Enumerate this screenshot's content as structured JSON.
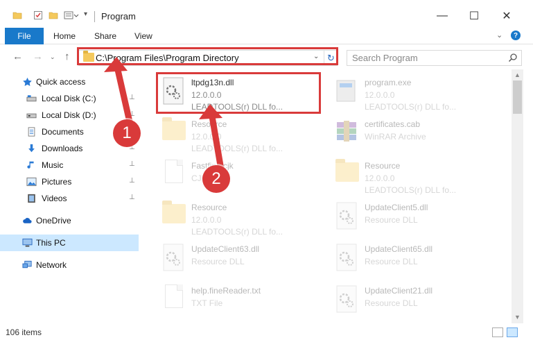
{
  "window": {
    "title": "Program",
    "minimize_glyph": "—",
    "maximize_glyph": "☐",
    "close_glyph": "✕"
  },
  "ribbon": {
    "tabs": [
      "File",
      "Home",
      "Share",
      "View"
    ],
    "help_label": "?"
  },
  "address": {
    "path": "C:\\Program Files\\Program Directory",
    "search_placeholder": "Search Program"
  },
  "nav": {
    "items": [
      {
        "label": "Quick access",
        "icon": "star-icon",
        "pinned": false
      },
      {
        "label": "Local Disk (C:)",
        "icon": "drive-icon",
        "pinned": true
      },
      {
        "label": "Local Disk (D:)",
        "icon": "drive-icon",
        "pinned": true
      },
      {
        "label": "Documents",
        "icon": "documents-icon",
        "pinned": true
      },
      {
        "label": "Downloads",
        "icon": "downloads-icon",
        "pinned": true
      },
      {
        "label": "Music",
        "icon": "music-icon",
        "pinned": true
      },
      {
        "label": "Pictures",
        "icon": "pictures-icon",
        "pinned": true
      },
      {
        "label": "Videos",
        "icon": "videos-icon",
        "pinned": true
      },
      {
        "label": "OneDrive",
        "icon": "onedrive-icon",
        "pinned": false
      },
      {
        "label": "This PC",
        "icon": "pc-icon",
        "pinned": false,
        "selected": true
      },
      {
        "label": "Network",
        "icon": "network-icon",
        "pinned": false
      }
    ],
    "pin_glyph": "📌"
  },
  "files": [
    {
      "name": "ltpdg13n.dll",
      "meta": "12.0.0.0",
      "meta2": "LEADTOOLS(r) DLL fo...",
      "kind": "dll-gear",
      "highlight": true
    },
    {
      "name": "program.exe",
      "meta": "12.0.0.0",
      "meta2": "LEADTOOLS(r) DLL fo...",
      "kind": "exe"
    },
    {
      "name": "Resource",
      "meta": "12.0.0.0",
      "meta2": "LEADTOOLS(r) DLL fo...",
      "kind": "folder"
    },
    {
      "name": "certificates.cab",
      "meta": "WinRAR Archive",
      "meta2": "",
      "kind": "archive"
    },
    {
      "name": "Fastfind.cjk",
      "meta": "CJK File",
      "meta2": "",
      "kind": "doc"
    },
    {
      "name": "Resource",
      "meta": "12.0.0.0",
      "meta2": "LEADTOOLS(r) DLL fo...",
      "kind": "folder"
    },
    {
      "name": "Resource",
      "meta": "12.0.0.0",
      "meta2": "LEADTOOLS(r) DLL fo...",
      "kind": "folder"
    },
    {
      "name": "UpdateClient5.dll",
      "meta": "Resource DLL",
      "meta2": "",
      "kind": "dll-gear"
    },
    {
      "name": "UpdateClient63.dll",
      "meta": "Resource DLL",
      "meta2": "",
      "kind": "dll-gear"
    },
    {
      "name": "UpdateClient65.dll",
      "meta": "Resource DLL",
      "meta2": "",
      "kind": "dll-gear"
    },
    {
      "name": "help.fineReader.txt",
      "meta": "TXT File",
      "meta2": "",
      "kind": "doc"
    },
    {
      "name": "UpdateClient21.dll",
      "meta": "Resource DLL",
      "meta2": "",
      "kind": "dll-gear"
    }
  ],
  "status": {
    "item_count": "106 items"
  },
  "annotations": {
    "badge1": "1",
    "badge2": "2"
  },
  "colors": {
    "accent": "#1979ca",
    "highlight_red": "#d93a3a",
    "selected_bg": "#cce8ff"
  }
}
